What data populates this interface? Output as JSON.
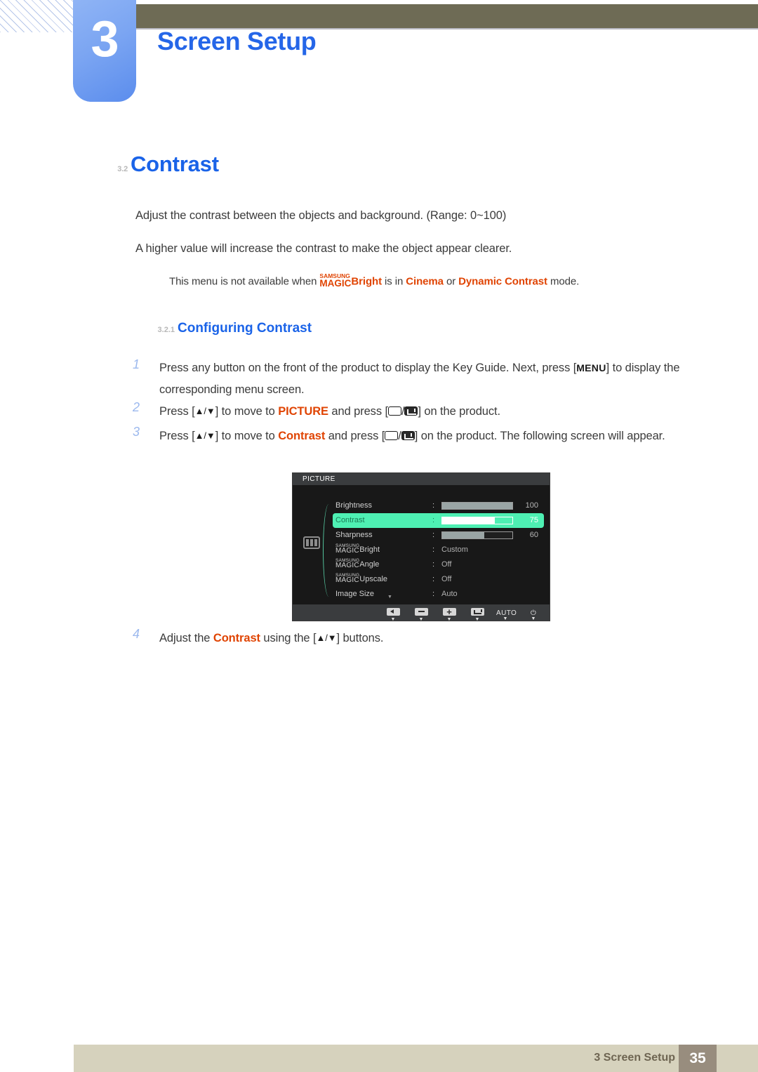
{
  "header": {
    "chapter_number": "3",
    "chapter_title": "Screen Setup",
    "accent_blue": "#2566e8",
    "olive": "#6e6b55"
  },
  "section": {
    "number": "3.2",
    "title": "Contrast"
  },
  "paragraphs": {
    "p1": "Adjust the contrast between the objects and background. (Range: 0~100)",
    "p2": "A higher value will increase the contrast to make the object appear clearer."
  },
  "note": {
    "prefix": "This menu is not available when ",
    "logo_top": "SAMSUNG",
    "logo_bottom": "MAGIC",
    "logo_word": "Bright",
    "mid": " is in ",
    "mode_1": "Cinema",
    "conj": " or ",
    "mode_2": "Dynamic Contrast",
    "suffix": " mode.",
    "accent": "#e04403"
  },
  "subsection": {
    "number": "3.2.1",
    "title": "Configuring Contrast"
  },
  "steps": [
    {
      "number": "1",
      "text_a": "Press any button on the front of the product to display the Key Guide. Next, press [",
      "key": "MENU",
      "text_b": "] to display the corresponding menu screen."
    },
    {
      "number": "2",
      "text_a": "Press [",
      "arrows": "▲/▼",
      "text_b": "] to move to ",
      "target": "PICTURE",
      "text_c": " and press [",
      "text_d": "] on the product."
    },
    {
      "number": "3",
      "text_a": "Press [",
      "arrows": "▲/▼",
      "text_b": "] to move to ",
      "target": "Contrast",
      "text_c": " and press [",
      "text_d": "] on the product. The following screen will appear."
    },
    {
      "number": "4",
      "text_a": "Adjust the ",
      "target": "Contrast",
      "text_b": " using the [",
      "arrows": "▲/▼",
      "text_c": "] buttons."
    }
  ],
  "osd": {
    "title": "PICTURE",
    "highlight_color": "#4ef0b3",
    "rows": [
      {
        "label": "Brightness",
        "type": "slider",
        "value": "100",
        "percent": 100,
        "highlight": false
      },
      {
        "label": "Contrast",
        "type": "slider",
        "value": "75",
        "percent": 75,
        "highlight": true
      },
      {
        "label": "Sharpness",
        "type": "slider",
        "value": "60",
        "percent": 60,
        "highlight": false
      },
      {
        "label": "Bright",
        "type": "magic",
        "value": "Custom",
        "highlight": false
      },
      {
        "label": "Angle",
        "type": "magic",
        "value": "Off",
        "highlight": false
      },
      {
        "label": "Upscale",
        "type": "magic",
        "value": "Off",
        "highlight": false
      },
      {
        "label": "Image Size",
        "type": "text",
        "value": "Auto",
        "highlight": false
      }
    ],
    "magic_top": "SAMSUNG",
    "magic_bottom": "MAGIC",
    "more_indicator": "▼",
    "buttons": [
      {
        "name": "back",
        "label": ""
      },
      {
        "name": "minus",
        "label": ""
      },
      {
        "name": "plus",
        "label": ""
      },
      {
        "name": "enter",
        "label": ""
      },
      {
        "name": "auto",
        "label": "AUTO"
      },
      {
        "name": "power",
        "label": "⏻"
      }
    ]
  },
  "footer": {
    "text": "3 Screen Setup",
    "page": "35"
  }
}
